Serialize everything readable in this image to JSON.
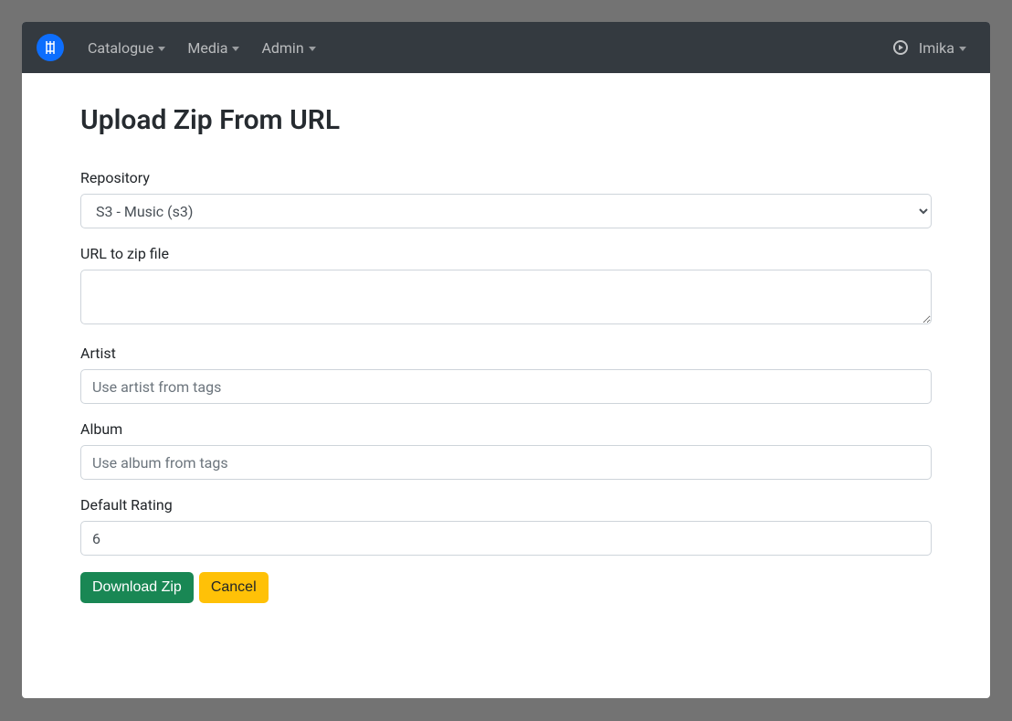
{
  "nav": {
    "items": [
      "Catalogue",
      "Media",
      "Admin"
    ],
    "user": "Imika"
  },
  "page": {
    "title": "Upload Zip From URL"
  },
  "form": {
    "repository": {
      "label": "Repository",
      "selected": "S3 - Music (s3)"
    },
    "url": {
      "label": "URL to zip file",
      "value": ""
    },
    "artist": {
      "label": "Artist",
      "placeholder": "Use artist from tags",
      "value": ""
    },
    "album": {
      "label": "Album",
      "placeholder": "Use album from tags",
      "value": ""
    },
    "rating": {
      "label": "Default Rating",
      "value": "6"
    },
    "buttons": {
      "submit": "Download Zip",
      "cancel": "Cancel"
    }
  }
}
